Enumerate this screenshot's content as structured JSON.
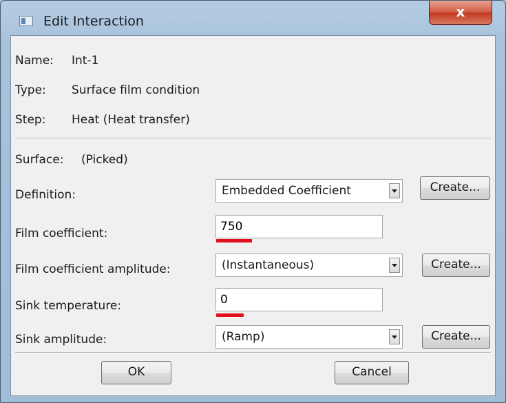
{
  "window": {
    "title": "Edit Interaction",
    "close_glyph": "x"
  },
  "info": {
    "name_label": "Name:",
    "name_value": "Int-1",
    "type_label": "Type:",
    "type_value": "Surface film condition",
    "step_label": "Step:",
    "step_value": "Heat (Heat transfer)",
    "surface_label": "Surface:",
    "surface_value": "(Picked)"
  },
  "form": {
    "definition": {
      "label": "Definition:",
      "value": "Embedded Coefficient",
      "button": "Create..."
    },
    "film_coefficient": {
      "label": "Film coefficient:",
      "value": "750"
    },
    "film_amplitude": {
      "label": "Film coefficient amplitude:",
      "value": "(Instantaneous)",
      "button": "Create..."
    },
    "sink_temperature": {
      "label": "Sink temperature:",
      "value": "0"
    },
    "sink_amplitude": {
      "label": "Sink amplitude:",
      "value": "(Ramp)",
      "button": "Create..."
    }
  },
  "buttons": {
    "ok": "OK",
    "cancel": "Cancel"
  },
  "colors": {
    "highlight": "#e0101e",
    "close_button": "#c23c22"
  },
  "icons": {
    "app": "window-icon",
    "close": "close-icon",
    "dropdown": "chevron-down-icon"
  }
}
